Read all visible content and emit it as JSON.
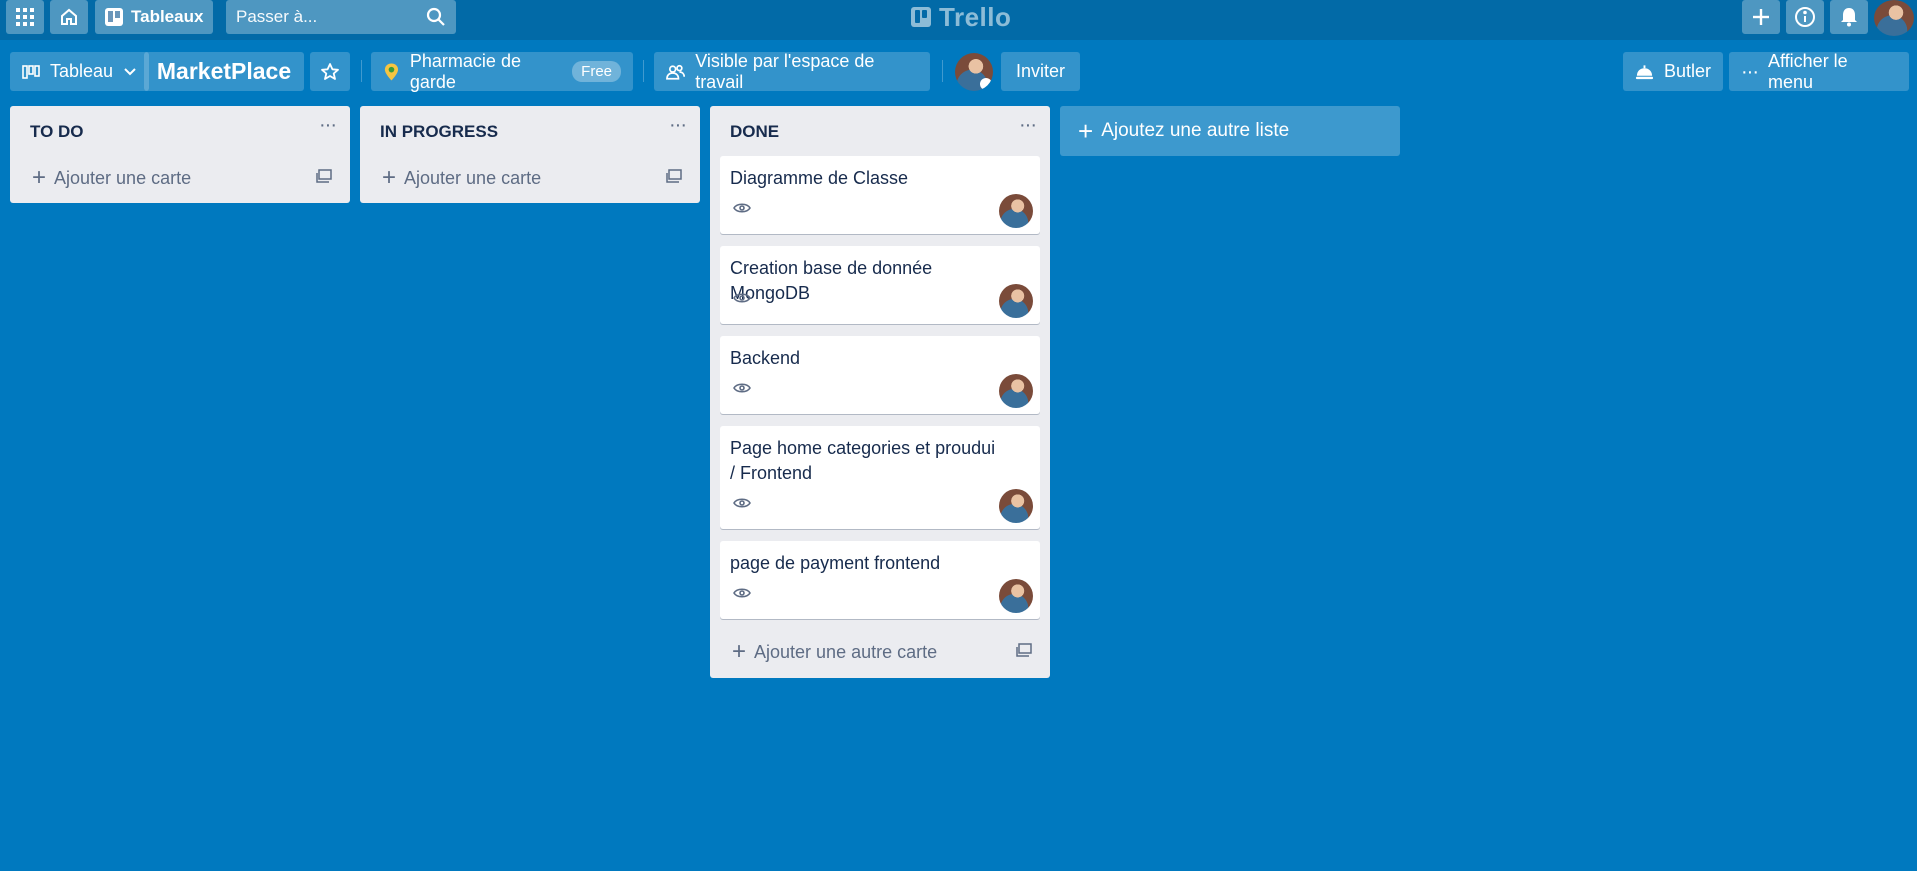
{
  "header": {
    "apps_icon": "grid-icon",
    "home_icon": "home-icon",
    "boards_label": "Tableaux",
    "search_placeholder": "Passer à...",
    "logo_text": "Trello",
    "create_icon": "plus-icon",
    "info_icon": "info-icon",
    "notifications_icon": "bell-icon"
  },
  "board_header": {
    "view_label": "Tableau",
    "board_name": "MarketPlace",
    "star_icon": "star-icon",
    "workspace_name": "Pharmacie de garde",
    "workspace_badge": "Free",
    "visibility_label": "Visible par l'espace de travail",
    "invite_label": "Inviter",
    "butler_label": "Butler",
    "menu_label": "Afficher le menu"
  },
  "lists": [
    {
      "title": "TO DO",
      "add_card_label": "Ajouter une carte"
    },
    {
      "title": "IN PROGRESS",
      "add_card_label": "Ajouter une carte"
    },
    {
      "title": "DONE",
      "add_card_label": "Ajouter une autre carte",
      "cards": [
        {
          "title": "Diagramme de Classe"
        },
        {
          "title": "Creation base de donnée MongoDB"
        },
        {
          "title": "Backend"
        },
        {
          "title": "Page home categories et proudui / Frontend"
        },
        {
          "title": "page de payment frontend"
        }
      ]
    }
  ],
  "add_list_label": "Ajoutez une autre liste",
  "colors": {
    "board_background": "#0079bf",
    "header_background": "#026aa7",
    "list_background": "#ebecf0"
  }
}
